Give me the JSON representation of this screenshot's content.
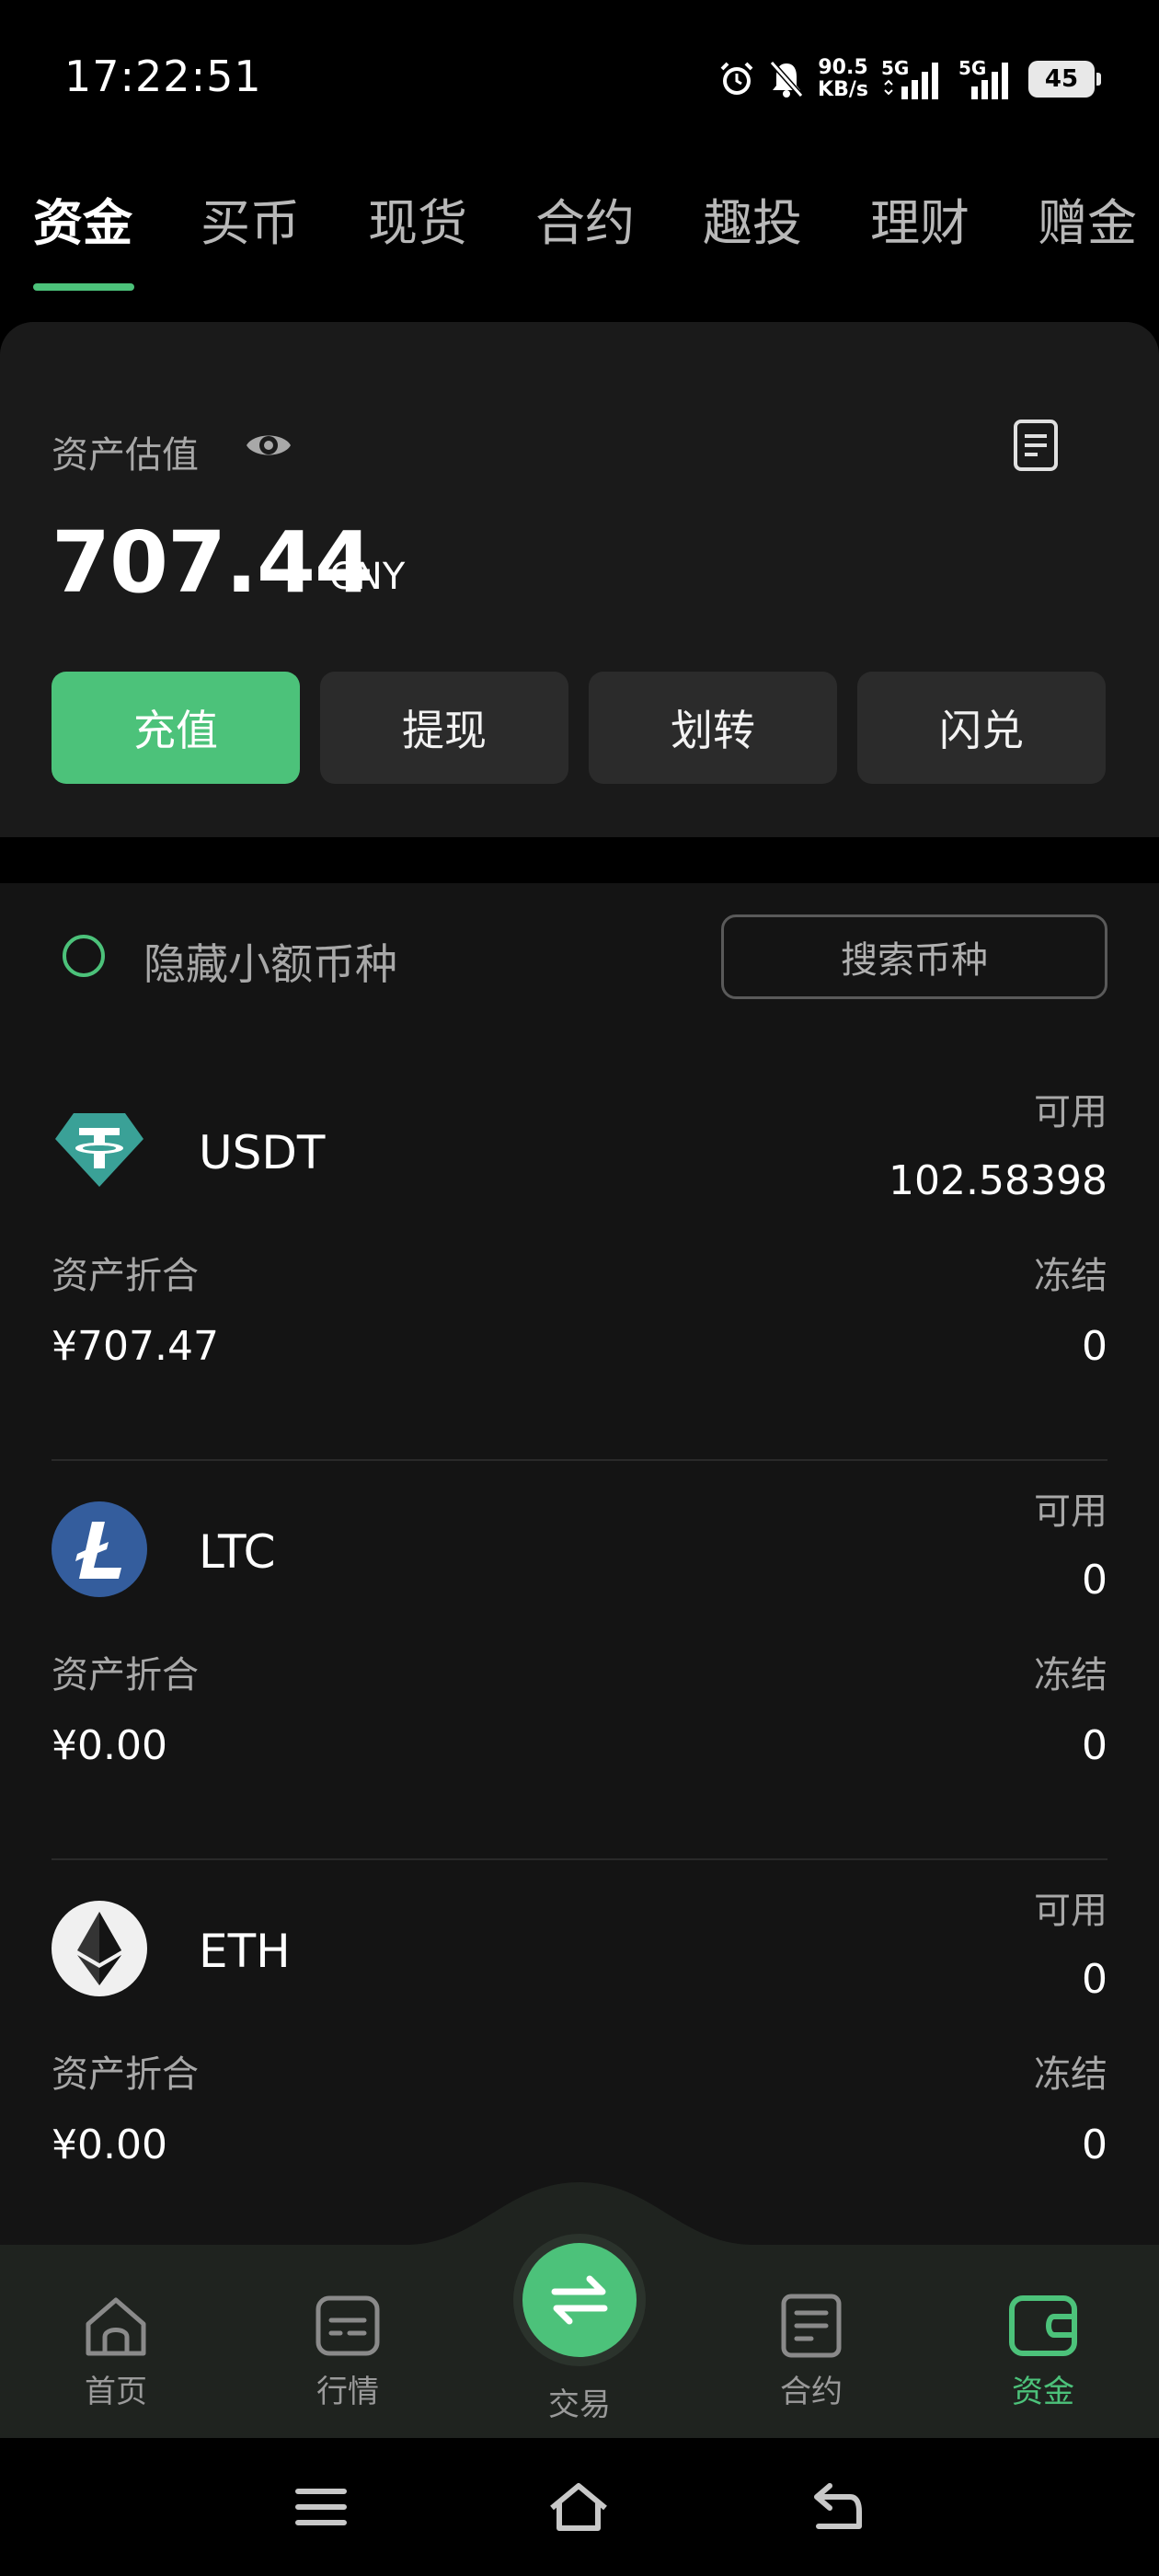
{
  "status_bar": {
    "time": "17:22:51",
    "net_speed_value": "90.5",
    "net_speed_unit": "KB/s",
    "signal_label_1": "5G",
    "signal_label_2": "5G",
    "battery": "45",
    "icons": [
      "alarm-icon",
      "mute-bell-icon",
      "signal-icon",
      "signal-icon",
      "battery-icon"
    ]
  },
  "tabs": [
    {
      "label": "资金",
      "active": true
    },
    {
      "label": "买币",
      "active": false
    },
    {
      "label": "现货",
      "active": false
    },
    {
      "label": "合约",
      "active": false
    },
    {
      "label": "趣投",
      "active": false
    },
    {
      "label": "理财",
      "active": false
    },
    {
      "label": "赠金",
      "active": false
    }
  ],
  "asset_card": {
    "label": "资产估值",
    "value": "707.44",
    "unit": "CNY",
    "icons": [
      "eye-icon",
      "record-icon"
    ],
    "buttons": [
      "充值",
      "提现",
      "划转",
      "闪兑"
    ]
  },
  "filter": {
    "hide_small_label": "隐藏小额币种",
    "search_label": "搜索币种"
  },
  "coins": [
    {
      "symbol": "USDT",
      "available_label": "可用",
      "available": "102.58398",
      "fold_label": "资产折合",
      "fold_value": "¥707.47",
      "frozen_label": "冻结",
      "frozen": "0",
      "icon": "usdt-icon"
    },
    {
      "symbol": "LTC",
      "available_label": "可用",
      "available": "0",
      "fold_label": "资产折合",
      "fold_value": "¥0.00",
      "frozen_label": "冻结",
      "frozen": "0",
      "icon": "ltc-icon"
    },
    {
      "symbol": "ETH",
      "available_label": "可用",
      "available": "0",
      "fold_label": "资产折合",
      "fold_value": "¥0.00",
      "frozen_label": "冻结",
      "frozen": "0",
      "icon": "eth-icon"
    }
  ],
  "bottom_nav": {
    "items": [
      {
        "label": "首页",
        "icon": "home-icon"
      },
      {
        "label": "行情",
        "icon": "market-icon"
      },
      {
        "label": "交易",
        "icon": "swap-icon"
      },
      {
        "label": "合约",
        "icon": "contract-icon"
      },
      {
        "label": "资金",
        "icon": "wallet-icon"
      }
    ],
    "active": "资金",
    "accent": "#4cc27a"
  },
  "colors": {
    "accent": "#4cc27a",
    "background": "#000000",
    "card": "#1a1a1a",
    "list": "#141414"
  }
}
